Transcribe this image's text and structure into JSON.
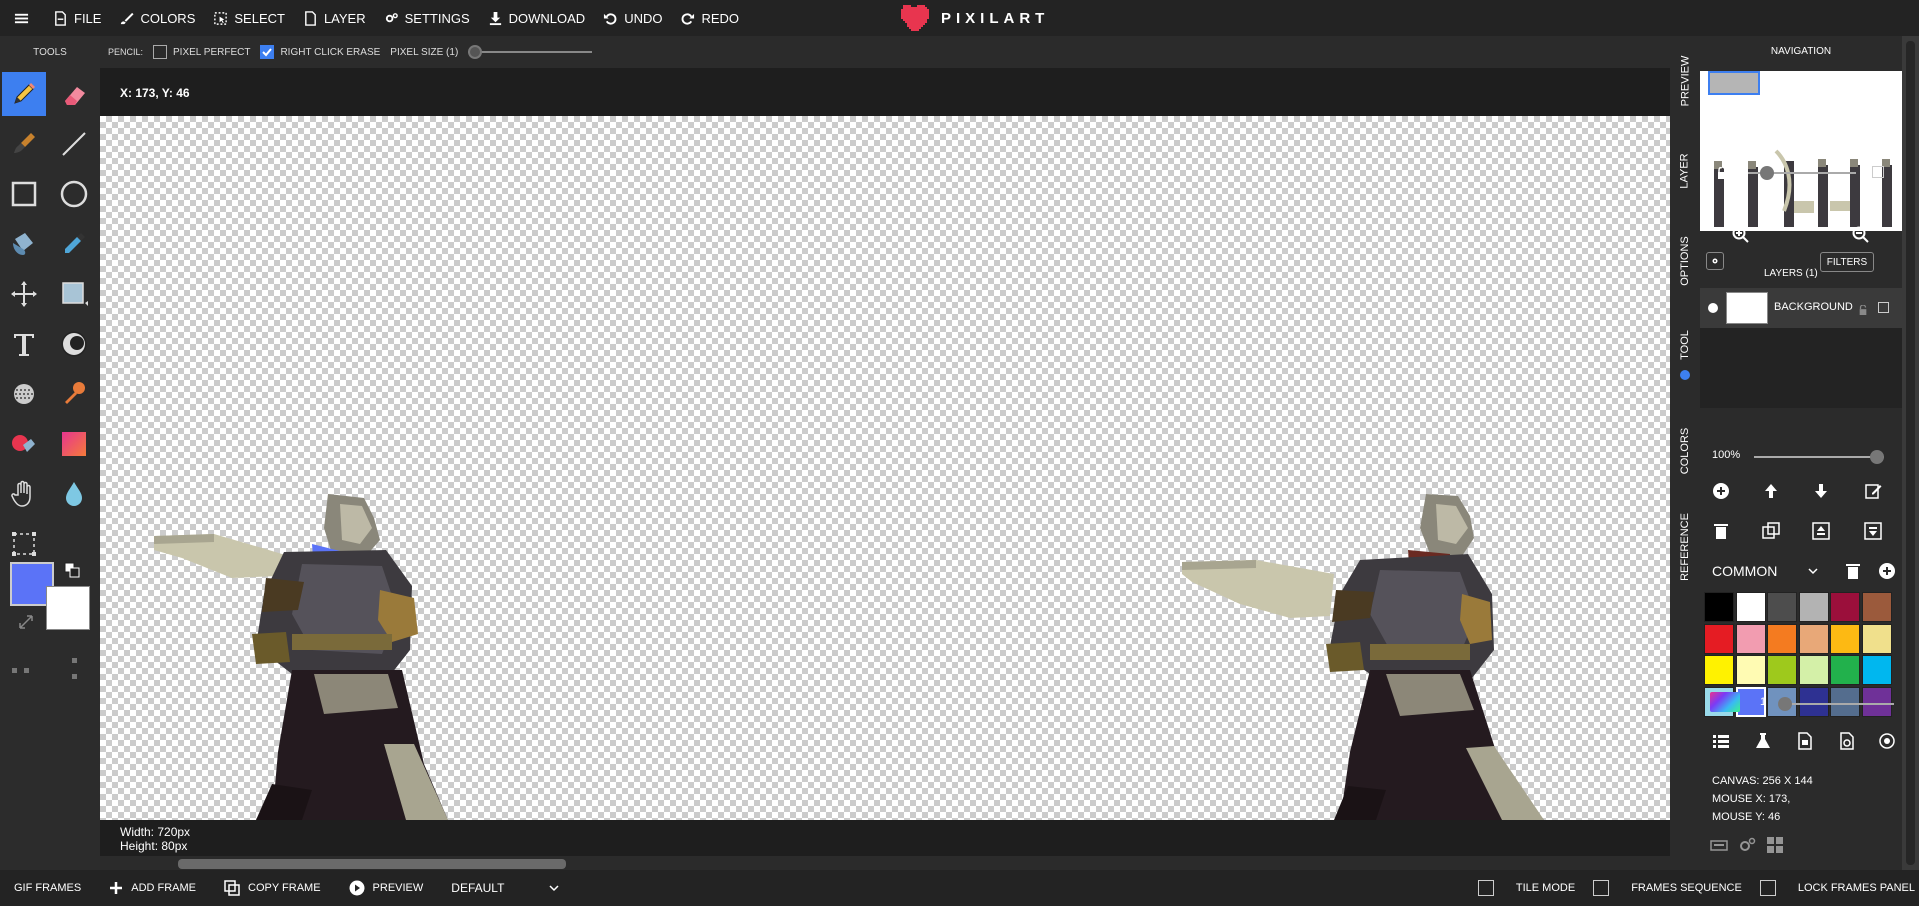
{
  "menu": {
    "file": "FILE",
    "colors": "COLORS",
    "select": "SELECT",
    "layer": "LAYER",
    "settings": "SETTINGS",
    "download": "DOWNLOAD",
    "undo": "UNDO",
    "redo": "REDO",
    "logo": "PIXILART"
  },
  "tools_title": "TOOLS",
  "tool_options": {
    "tool": "PENCIL:",
    "pixel_perfect": "PIXEL PERFECT",
    "pixel_perfect_checked": false,
    "right_click_erase": "RIGHT CLICK ERASE",
    "right_click_erase_checked": true,
    "pixel_size": "PIXEL SIZE (1)"
  },
  "coords": "X: 173, Y: 46",
  "canvas_info": {
    "width": "Width: 720px",
    "height": "Height: 80px"
  },
  "footer": {
    "gif_frames": "GIF FRAMES",
    "add_frame": "ADD FRAME",
    "copy_frame": "COPY FRAME",
    "preview": "PREVIEW",
    "animation": "DEFAULT",
    "tile_mode": "TILE MODE",
    "frames_sequence": "FRAMES SEQUENCE",
    "lock_frames": "LOCK FRAMES PANEL"
  },
  "vtabs": [
    "PREVIEW",
    "LAYER",
    "OPTIONS",
    "TOOL",
    "COLORS",
    "REFERENCE"
  ],
  "navigation": {
    "title": "NAVIGATION"
  },
  "layers": {
    "title": "LAYERS (1)",
    "filters": "FILTERS",
    "layer_name": "BACKGROUND",
    "opacity": "100%"
  },
  "palette": {
    "name": "COMMON",
    "brush_size": "1",
    "colors": [
      "#000000",
      "#ffffff",
      "#4d4d4d",
      "#b3b3b3",
      "#9b0f3b",
      "#9b5a3c",
      "#e51c23",
      "#f29cb0",
      "#f47b20",
      "#e8a878",
      "#fdb913",
      "#f0e08c",
      "#fff200",
      "#fffbb3",
      "#9ec91c",
      "#d4f0a8",
      "#22b14c",
      "#00b7ef",
      "#99d9ea",
      "#5b73f7",
      "#7092be",
      "#2e3192",
      "#546d8e",
      "#6f3198"
    ],
    "selected_index": 19
  },
  "canvas_meta": {
    "canvas": "CANVAS: 256 X 144",
    "mouse_x": "MOUSE X: 173,",
    "mouse_y": "MOUSE Y: 46"
  },
  "active_colors": {
    "primary": "#5b73f7",
    "secondary": "#ffffff"
  }
}
